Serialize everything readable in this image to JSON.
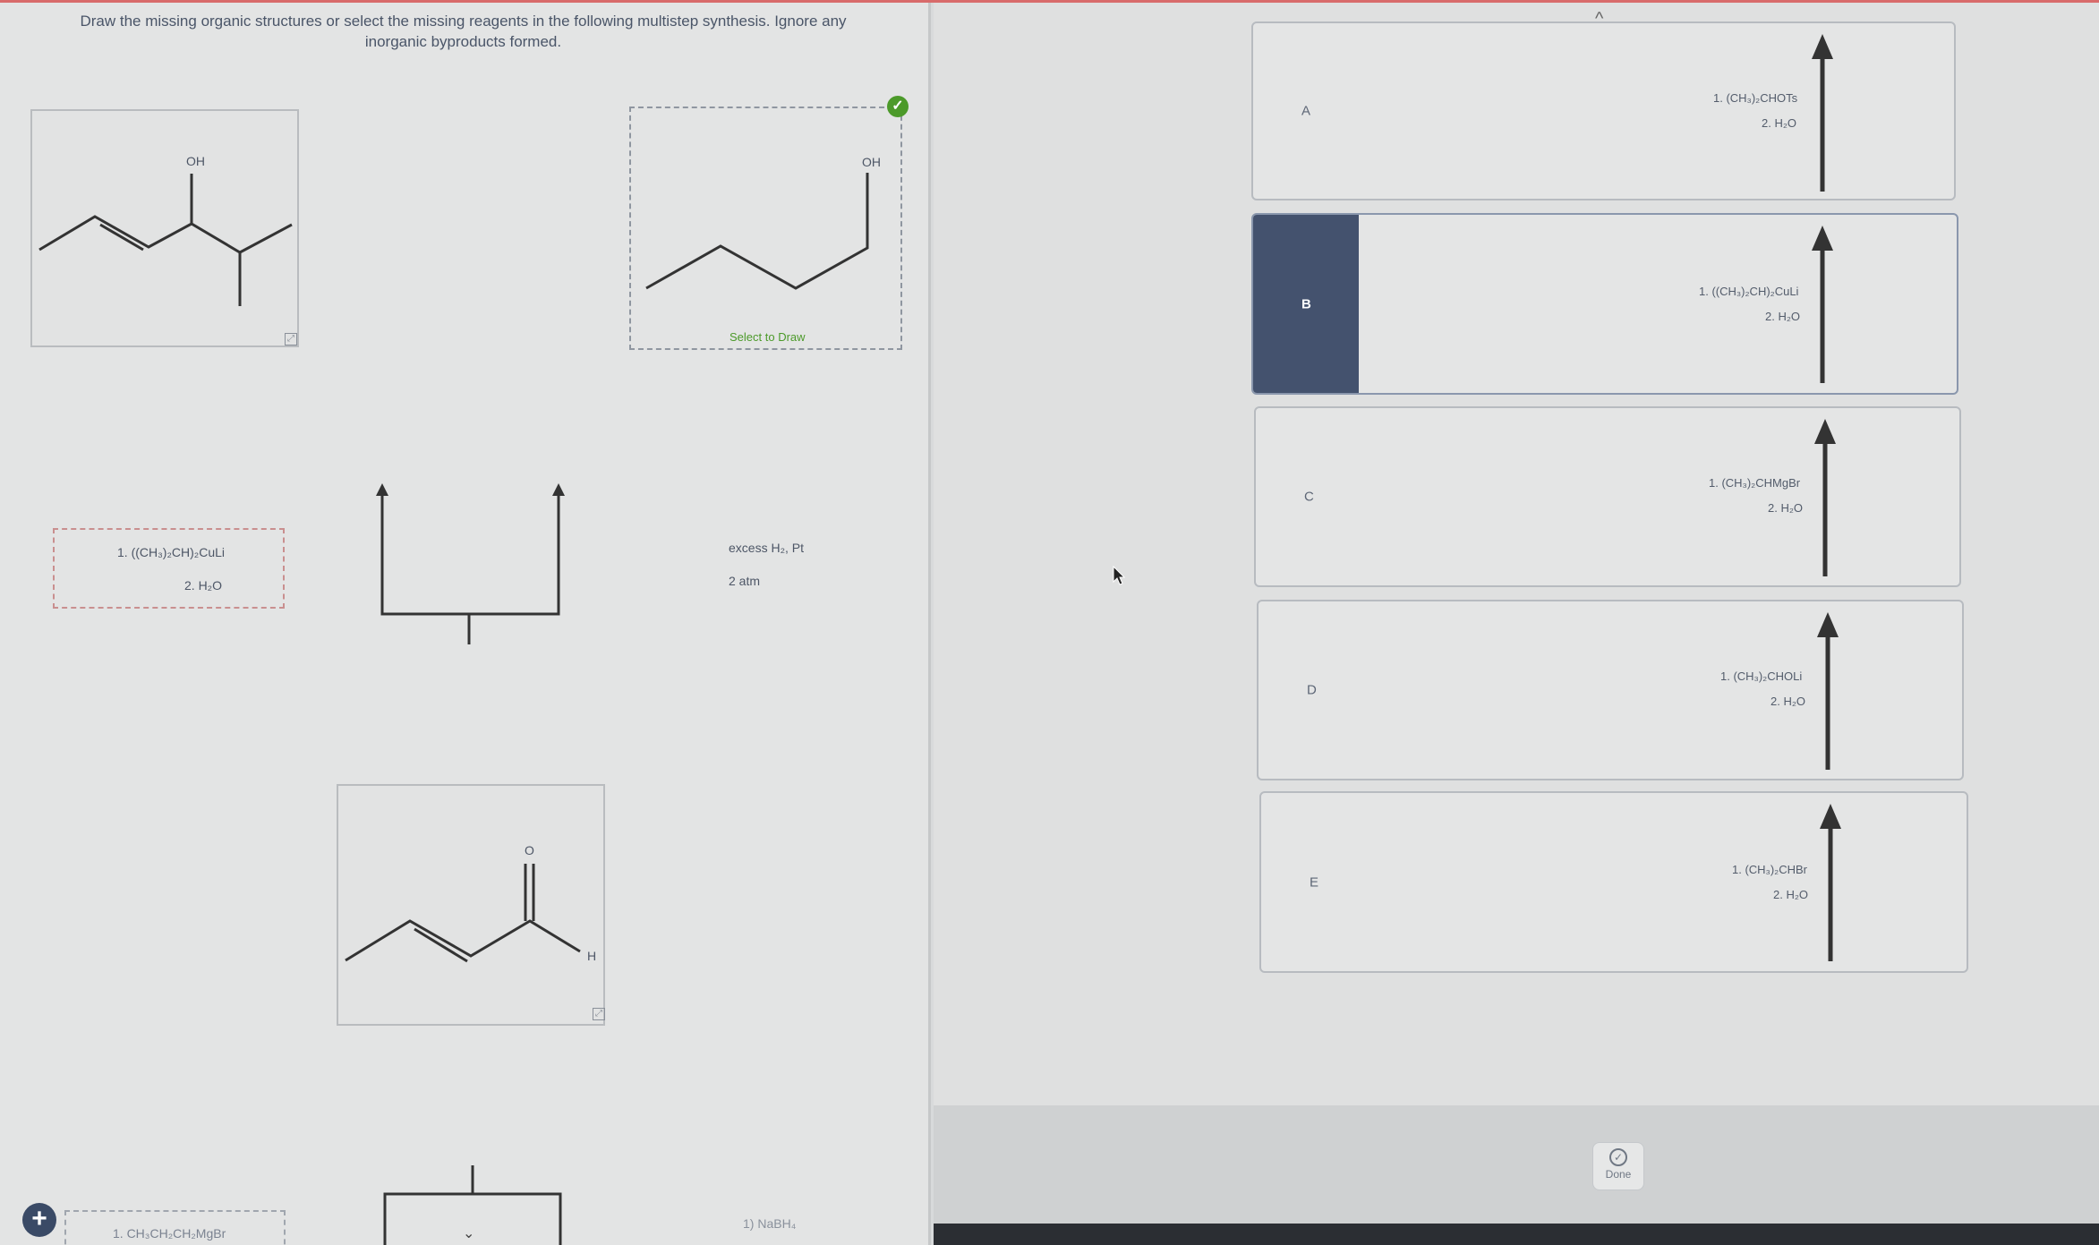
{
  "instructions": {
    "line1": "Draw the missing organic structures or select the missing reagents in the following multistep synthesis. Ignore any",
    "line2": "inorganic byproducts formed."
  },
  "step_top": {
    "start_oh_label": "OH",
    "product_oh_label": "OH",
    "select_to_draw": "Select to Draw"
  },
  "step_middle": {
    "selected_reagent_line1": "1. ((CH₃)₂CH)₂CuLi",
    "selected_reagent_line2": "2. H₂O",
    "hydrogenation_line1": "excess H₂, Pt",
    "hydrogenation_line2": "2 atm"
  },
  "step_lower": {
    "aldehyde_o_label": "O",
    "aldehyde_h_label": "H"
  },
  "step_bottom": {
    "reagent_partial": "1. CH₃CH₂CH₂MgBr",
    "nabh4_partial": "1) NaBH₄"
  },
  "options": [
    {
      "letter": "A",
      "line1": "1. (CH₃)₂CHOTs",
      "line2": "2. H₂O",
      "selected": false
    },
    {
      "letter": "B",
      "line1": "1. ((CH₃)₂CH)₂CuLi",
      "line2": "2. H₂O",
      "selected": true
    },
    {
      "letter": "C",
      "line1": "1. (CH₃)₂CHMgBr",
      "line2": "2. H₂O",
      "selected": false
    },
    {
      "letter": "D",
      "line1": "1. (CH₃)₂CHOLi",
      "line2": "2. H₂O",
      "selected": false
    },
    {
      "letter": "E",
      "line1": "1. (CH₃)₂CHBr",
      "line2": "2. H₂O",
      "selected": false
    }
  ],
  "done_label": "Done",
  "colors": {
    "selected_tab": "#44526e",
    "check_green": "#4c9a2a"
  }
}
